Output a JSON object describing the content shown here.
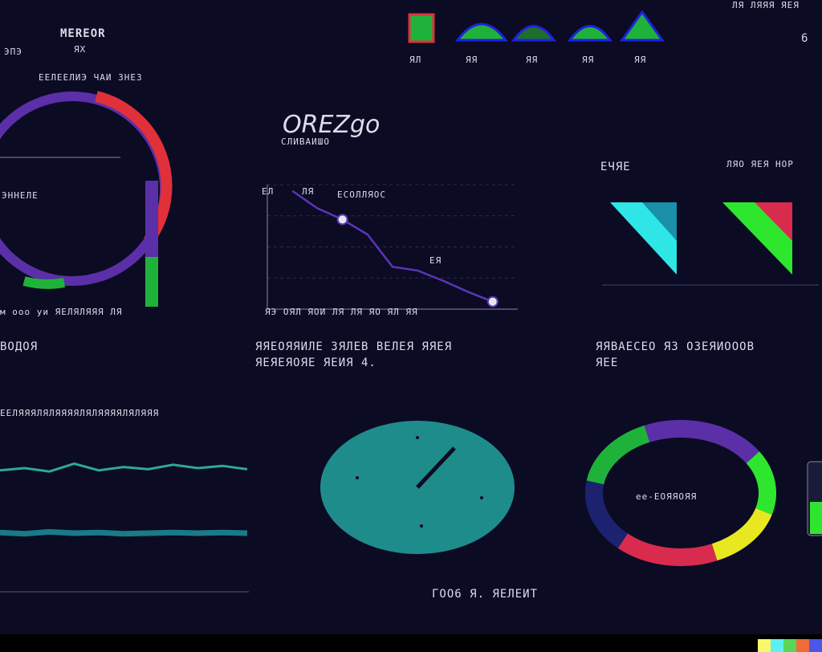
{
  "colors": {
    "background": "#0b0b24",
    "purple": "#5b2fa8",
    "green": "#1fb23a",
    "red": "#e0303a",
    "teal": "#1f8c8c",
    "cyan": "#2ee6e6",
    "lime": "#2ee62e",
    "yellow": "#e8e820",
    "crimson": "#d92b4e",
    "navy": "#1d2270",
    "wave1": "#2fa896",
    "wave2": "#1a7a86",
    "line": "#5b35b8"
  },
  "header": {
    "left_title": "MEREOR",
    "left_sub1": "ЭПЭ",
    "left_sub2": "ЯХ",
    "gauge_label1": "ЕЕЛЕЕЛИЭ ЧАИ ЗНЕЗ",
    "gauge_label2": "ЭННЕЛЕ",
    "gauge_axis": "м ооо уи ЯЕЛЯЛЯЯЯ ЛЯ",
    "icon_labels": [
      "ЯЛ",
      "ЯЯ",
      "ЯЯ",
      "ЯЯ",
      "ЯЯ"
    ],
    "top_right_text": "ЛЯ ЛЯЯЯ ЯЕЯ",
    "top_right_num": "6"
  },
  "line_panel": {
    "title": "OREZgo",
    "subtitle": "СЛИВАИШО",
    "legend_a": "ЕЛ",
    "legend_b": "ЛЯ",
    "legend_c": "ЕСОЛЛЯОС",
    "point_label": "ЕЯ",
    "x_axis_label": "ЯЭ ОЯЛ ЯОИ ЛЯ ЛЯ ЯО ЯЛ ЯЯ"
  },
  "triangles_panel": {
    "label_left": "ЕЧЯЕ",
    "label_right": "ЛЯО ЯЕЯ НОР"
  },
  "middle_row": {
    "left_heading": "ВОДОЯ",
    "center_heading1": "ЯЯЕОЯЯИЛЕ ЗЯЛЕВ ВЕЛЕЯ ЯЯЕЯ",
    "center_heading2": "ЯЕЯЕЯОЯЕ ЯЕИЯ 4.",
    "right_heading1": "ЯЯВАЕСЕО ЯЗ ОЗЕЯИОООВ",
    "right_heading2": "ЯЕЕ"
  },
  "bottom_row": {
    "wave_header": "ЕЕЛЯЯЯЛЯЛЯЯЯЯЛЯЛЯЯЯЯЛЯЛЯЯЯ",
    "donut_label": "ее-ЕОЯЯОЯЯ",
    "footer_caption": "ГОО6 Я. ЯЕЛЕИТ"
  },
  "footer_swatches": [
    "#f8f86a",
    "#5ef0f0",
    "#58d658",
    "#f06a3a",
    "#4a56e8"
  ],
  "chart_data": [
    {
      "type": "line",
      "x": [
        1,
        2,
        3,
        4,
        5,
        6,
        7,
        8,
        9
      ],
      "series": [
        {
          "values": [
            9.5,
            8.1,
            7.2,
            6.0,
            3.4,
            3.1,
            2.3,
            1.4,
            0.6
          ]
        }
      ],
      "xlim": [
        0,
        10
      ],
      "ylim": [
        0,
        10
      ],
      "grid": true
    },
    {
      "type": "pie",
      "categories": [
        "purple",
        "green",
        "yellow",
        "red",
        "navy",
        "lime"
      ],
      "values": [
        22,
        14,
        14,
        18,
        16,
        16
      ],
      "donut": true
    },
    {
      "type": "area",
      "x": [
        0,
        1,
        2,
        3,
        4,
        5,
        6,
        7,
        8,
        9,
        10
      ],
      "series": [
        {
          "values": [
            0.3,
            0.5,
            0.2,
            0.9,
            0.3,
            0.6,
            0.4,
            0.8,
            0.5,
            0.7,
            0.4
          ]
        },
        {
          "values": [
            0.6,
            0.4,
            0.7,
            0.5,
            0.6,
            0.4,
            0.5,
            0.6,
            0.5,
            0.6,
            0.5
          ]
        }
      ]
    }
  ]
}
